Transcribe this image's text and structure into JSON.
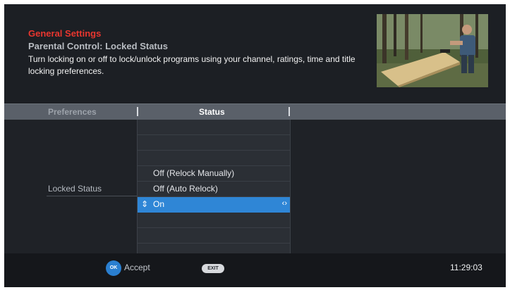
{
  "header": {
    "title": "General Settings",
    "subtitle": "Parental Control: Locked Status",
    "description": "Turn locking on or off to lock/unlock programs using your channel, ratings, time and title locking preferences."
  },
  "columns": {
    "preferences": "Preferences",
    "status": "Status"
  },
  "preference": {
    "label": "Locked Status"
  },
  "status_options": [
    {
      "label": "Off (Relock Manually)",
      "selected": false
    },
    {
      "label": "Off (Auto Relock)",
      "selected": false
    },
    {
      "label": "On",
      "selected": true
    }
  ],
  "footer": {
    "ok_button_label": "OK",
    "accept_label": "Accept",
    "exit_button_label": "EXIT",
    "clock": "11:29:03"
  },
  "colors": {
    "title": "#e8362f",
    "selection": "#2f86d6"
  },
  "icons": {
    "selection_left": "up-down-arrows-icon",
    "selection_right": "left-right-arrows-icon"
  }
}
